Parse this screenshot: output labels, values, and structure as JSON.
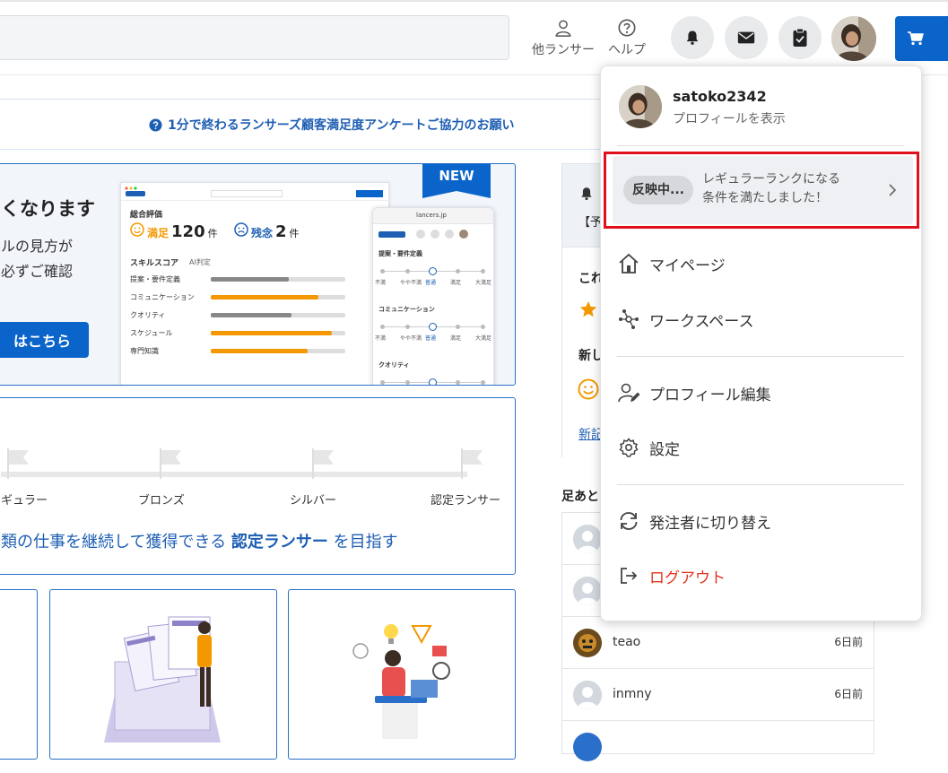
{
  "header": {
    "other_lancers_label": "他ランサー",
    "help_label": "ヘルプ"
  },
  "survey": {
    "text": "1分で終わるランサーズ顧客満足度アンケートご協力のお願い"
  },
  "promo": {
    "heading": "くなります",
    "body": "ルの見方が\n必ずご確認",
    "button_label": "はこちら",
    "new_badge": "NEW",
    "mock": {
      "overall_rating_label": "総合評価",
      "satisfied_label": "満足",
      "satisfied_count": "120",
      "disappointed_label": "残念",
      "disappointed_count": "2",
      "count_unit": "件",
      "skill_score_label": "スキルスコア",
      "ai_label": "AI判定",
      "skills": [
        {
          "label": "提案・要件定義",
          "level": 0.58,
          "color": "#888888"
        },
        {
          "label": "コミュニケーション",
          "level": 0.8,
          "color": "#f39800"
        },
        {
          "label": "クオリティ",
          "level": 0.6,
          "color": "#888888"
        },
        {
          "label": "スケジュール",
          "level": 0.9,
          "color": "#f39800"
        },
        {
          "label": "専門知識",
          "level": 0.72,
          "color": "#f39800"
        }
      ],
      "phone_url": "lancers.jp",
      "phone_sections": [
        "提案・要件定義",
        "コミュニケーション",
        "クオリティ"
      ],
      "phone_scale": [
        "不満",
        "やや不満",
        "普通",
        "満足",
        "大満足"
      ]
    }
  },
  "rank": {
    "labels": [
      "ギュラー",
      "ブロンズ",
      "シルバー",
      "認定ランサー"
    ],
    "message_prefix": "類の仕事を継続して獲得できる",
    "message_bold": "認定ランサー",
    "message_suffix": "を目指す"
  },
  "right_column": {
    "notice_snippet": "【予",
    "section1_snippet": "これ",
    "section2_snippet": "新し",
    "link_snippet": "新記",
    "footprints_title": "足あと",
    "footprints": [
      {
        "name": "",
        "time": ""
      },
      {
        "name": "",
        "time": ""
      },
      {
        "name": "teao",
        "time": "6日前"
      },
      {
        "name": "inmny",
        "time": "6日前"
      }
    ]
  },
  "dropdown": {
    "username": "satoko2342",
    "view_profile": "プロフィールを表示",
    "rank_status": "反映中...",
    "rank_message": "レギュラーランクになる\n条件を満たしました！",
    "items": {
      "mypage": "マイページ",
      "workspace": "ワークスペース",
      "profile_edit": "プロフィール編集",
      "settings": "設定",
      "switch_client": "発注者に切り替え",
      "logout": "ログアウト"
    }
  },
  "colors": {
    "brand_blue": "#0b64c9",
    "link_blue": "#1e5fb4",
    "logout_red": "#e0341d",
    "highlight_red": "#e0101d",
    "orange": "#f39800"
  }
}
